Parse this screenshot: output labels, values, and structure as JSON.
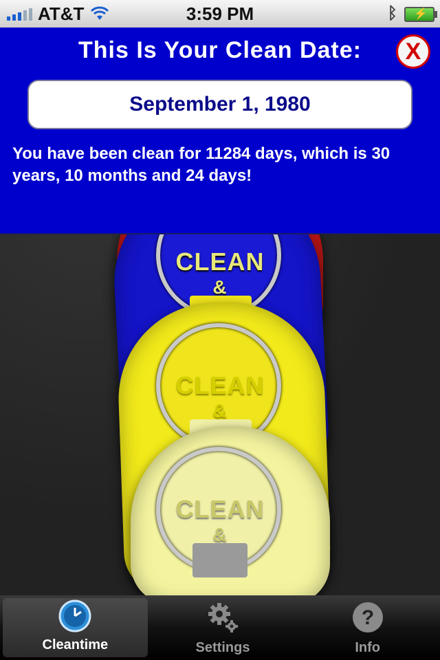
{
  "status_bar": {
    "carrier": "AT&T",
    "time": "3:59 PM",
    "icons": [
      "signal-icon",
      "wifi-icon",
      "bluetooth-icon",
      "battery-icon"
    ]
  },
  "panel": {
    "title": "This Is Your Clean Date:",
    "date": "September 1, 1980",
    "message": "You have been clean for 11284 days, which is 30 years, 10 months and 24 days!",
    "close_label": "X",
    "colors": {
      "background": "#0000CC",
      "close": "#D10000"
    }
  },
  "keytags": [
    {
      "text_line1": "CLEAN",
      "text_line2": "&",
      "color": "#1414C8"
    },
    {
      "text_line1": "CLEAN",
      "text_line2": "&",
      "color": "#F2EA1A"
    },
    {
      "text_line1": "CLEAN",
      "text_line2": "&",
      "color": "#F4F4A0"
    }
  ],
  "tab_bar": {
    "tabs": [
      {
        "label": "Cleantime",
        "icon": "clock-icon",
        "active": true
      },
      {
        "label": "Settings",
        "icon": "gear-icon",
        "active": false
      },
      {
        "label": "Info",
        "icon": "question-icon",
        "active": false
      }
    ]
  }
}
